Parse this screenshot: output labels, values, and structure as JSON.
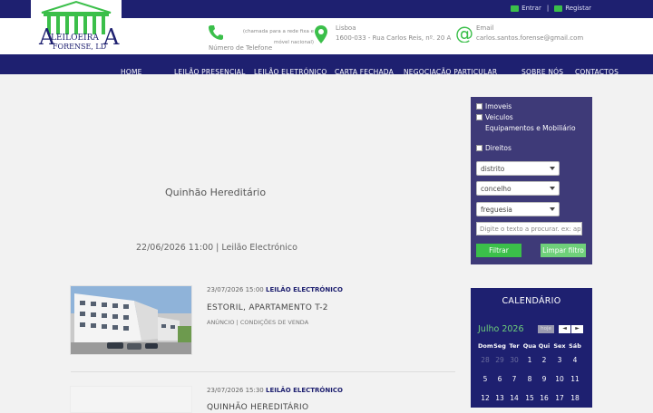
{
  "topbar": {
    "login_label": "Entrar",
    "separator": "|",
    "register_label": "Registar"
  },
  "logo": {
    "line1": "LEILOEIRA",
    "line2": "FORENSE, LD"
  },
  "contact": {
    "phone_note": "(chamada para a rede fixa e móvel nacional)",
    "phone_label": "Número de Telefone",
    "city": "Lisboa",
    "address": "1600-033 - Rua Carlos Reis, nº. 20 A",
    "email_label": "Email",
    "email": "carlos.santos.forense@gmail.com"
  },
  "nav": [
    "HOME",
    "LEILÃO PRESENCIAL",
    "LEILÃO ELETRÓNICO",
    "CARTA FECHADA",
    "NEGOCIAÇÃO PARTICULAR",
    "SOBRE NÓS",
    "CONTACTOS"
  ],
  "page": {
    "title": "Quinhão Hereditário",
    "date_line": "22/06/2026 11:00 | Leilão Electrónico"
  },
  "listings": [
    {
      "date": "23/07/2026 15:00",
      "type": "LEILÃO ELECTRÓNICO",
      "title": "ESTORIL, APARTAMENTO T-2",
      "links": "ANÚNCIO | CONDIÇÕES DE VENDA"
    },
    {
      "date": "23/07/2026 15:30",
      "type": "LEILÃO ELECTRÓNICO",
      "title": "QUINHÃO HEREDITÁRIO",
      "links": ""
    }
  ],
  "filter": {
    "checkboxes": [
      "Imoveis",
      "Veiculos",
      "Equipamentos e Mobiliário",
      "Direitos"
    ],
    "selects": [
      "distrito",
      "concelho",
      "freguesia"
    ],
    "search_placeholder": "Digite o texto a procurar. ex: apar",
    "filter_button": "Filtrar",
    "clear_button": "Limpar filtro",
    "filter_color": "#3bbf4a",
    "clear_color": "#6fd07a"
  },
  "calendar": {
    "title": "CALENDÁRIO",
    "month": "Julho 2026",
    "today_label": "hoje",
    "prev": "◄",
    "next": "►",
    "weekdays": [
      "Dom",
      "Seg",
      "Ter",
      "Qua",
      "Qui",
      "Sex",
      "Sáb"
    ],
    "weeks": [
      [
        "28",
        "29",
        "30",
        "1",
        "2",
        "3",
        "4"
      ],
      [
        "5",
        "6",
        "7",
        "8",
        "9",
        "10",
        "11"
      ],
      [
        "12",
        "13",
        "14",
        "15",
        "16",
        "17",
        "18"
      ]
    ]
  },
  "colors": {
    "navy": "#1e2070",
    "green": "#3bbf4a",
    "filter_bg": "#3e3a78"
  }
}
